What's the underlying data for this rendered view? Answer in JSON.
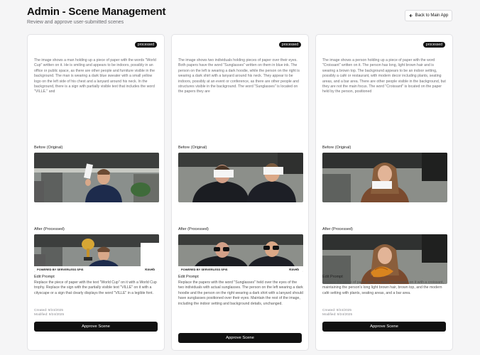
{
  "header": {
    "title": "Admin - Scene Management",
    "subtitle": "Review and approve user-submitted scenes",
    "back_label": "Back to Main App",
    "back_icon": "arrow-left-icon"
  },
  "cards": [
    {
      "badge": "processed",
      "description": "The image shows a man holding up a piece of paper with the words \"World Cup\" written on it. He is smiling and appears to be indoors, possibly in an office or public space, as there are other people and furniture visible in the background. The man is wearing a dark blue sweater with a small yellow logo on the left side of his chest and a lanyard around his neck. In the background, there is a sign with partially visible text that includes the word \"VILLE.\" and",
      "before_label": "Before (Original)",
      "after_label": "After (Processed)",
      "after_banner": "POWERED BY SERVERLESS SPIS",
      "after_brand": "Koveb",
      "edit_label": "Edit Prompt",
      "edit_prompt": "Replace the piece of paper with the text \"World Cup\" on it with a World Cup trophy. Replace the sign with the partially visible text \"VILLE\" on it with a cityscape or a sign that clearly displays the word \"VILLE\" in a legible font.",
      "created": "Created: 9/24/2025",
      "modified": "Modified: 9/24/2025",
      "approve_label": "Approve Scene"
    },
    {
      "badge": "processed",
      "description": "The image shows two individuals holding pieces of paper over their eyes. Both papers have the word \"Sunglasses\" written on them in blue ink. The person on the left is wearing a dark hoodie, while the person on the right is wearing a dark shirt with a lanyard around his neck. They appear to be indoors, possibly at an event or conference, as there are other people and structures visible in the background. The word \"Sunglasses\" is located on the papers they are",
      "before_label": "Before (Original)",
      "after_label": "After (Processed)",
      "after_banner": "POWERED BY SERVERLESS SPIS",
      "after_brand": "Koveb",
      "edit_label": "Edit Prompt",
      "edit_prompt": "Replace the papers with the word \"Sunglasses\" held over the eyes of the two individuals with actual sunglasses. The person on the left wearing a dark hoodie and the person on the right wearing a dark shirt with a lanyard should have sunglasses positioned over their eyes. Maintain the rest of the image, including the indoor setting and background details, unchanged.",
      "created": "Created: 9/24/2025",
      "modified": "Modified: 9/24/2025",
      "approve_label": "Approve Scene"
    },
    {
      "badge": "processed",
      "description": "The image shows a person holding up a piece of paper with the word \"Croissant\" written on it. The person has long, light brown hair and is wearing a brown top. The background appears to be an indoor setting, possibly a café or restaurant, with modern decor including plants, seating areas, and a bar area. There are other people visible in the background, but they are not the main focus. The word \"Croissant\" is located on the paper held by the person, positioned",
      "before_label": "Before (Original)",
      "after_label": "After (Processed)",
      "after_banner": "",
      "after_brand": "",
      "edit_label": "Edit Prompt",
      "edit_prompt": "Replace the piece of paper with the word \"Croissant\" on it with a croissant, maintaining the person's long light brown hair, brown top, and the modern café setting with plants, seating areas, and a bar area.",
      "created": "Created: 9/24/2025",
      "modified": "Modified: 9/24/2025",
      "approve_label": "Approve Scene"
    }
  ]
}
